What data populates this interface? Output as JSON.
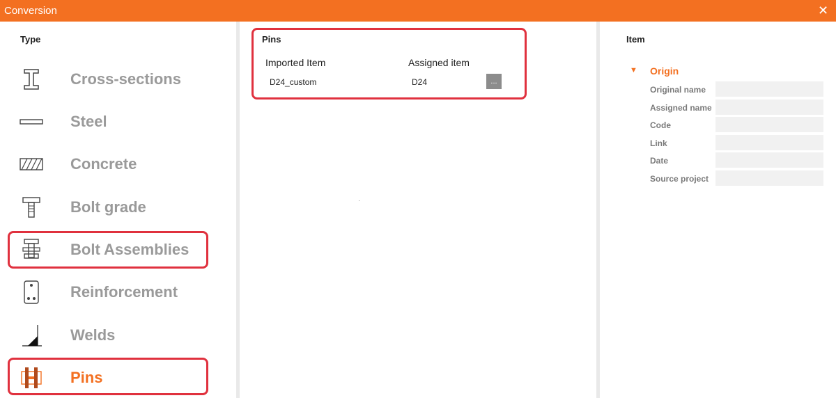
{
  "window": {
    "title": "Conversion",
    "close_glyph": "✕"
  },
  "type_panel": {
    "header": "Type",
    "items": [
      {
        "label": "Cross-sections",
        "icon": "cross-section-icon"
      },
      {
        "label": "Steel",
        "icon": "steel-icon"
      },
      {
        "label": "Concrete",
        "icon": "concrete-icon"
      },
      {
        "label": "Bolt grade",
        "icon": "bolt-grade-icon"
      },
      {
        "label": "Bolt Assemblies",
        "icon": "bolt-assembly-icon"
      },
      {
        "label": "Reinforcement",
        "icon": "reinforcement-icon"
      },
      {
        "label": "Welds",
        "icon": "weld-icon"
      },
      {
        "label": "Pins",
        "icon": "pin-icon",
        "selected": true
      }
    ]
  },
  "pins_panel": {
    "title": "Pins",
    "columns": [
      "Imported Item",
      "Assigned item"
    ],
    "rows": [
      {
        "imported": "D24_custom",
        "assigned": "D24",
        "action_label": "..."
      }
    ]
  },
  "item_panel": {
    "header": "Item",
    "group": {
      "label": "Origin",
      "expanded": true,
      "toggle_glyph": "▼"
    },
    "properties": [
      {
        "label": "Original name",
        "value": ""
      },
      {
        "label": "Assigned name",
        "value": ""
      },
      {
        "label": "Code",
        "value": ""
      },
      {
        "label": "Link",
        "value": ""
      },
      {
        "label": "Date",
        "value": ""
      },
      {
        "label": "Source project",
        "value": ""
      }
    ]
  },
  "colors": {
    "accent": "#f37021",
    "highlight": "#e0313e",
    "muted_text": "#9a9a9a",
    "field_bg": "#f1f1f1"
  }
}
